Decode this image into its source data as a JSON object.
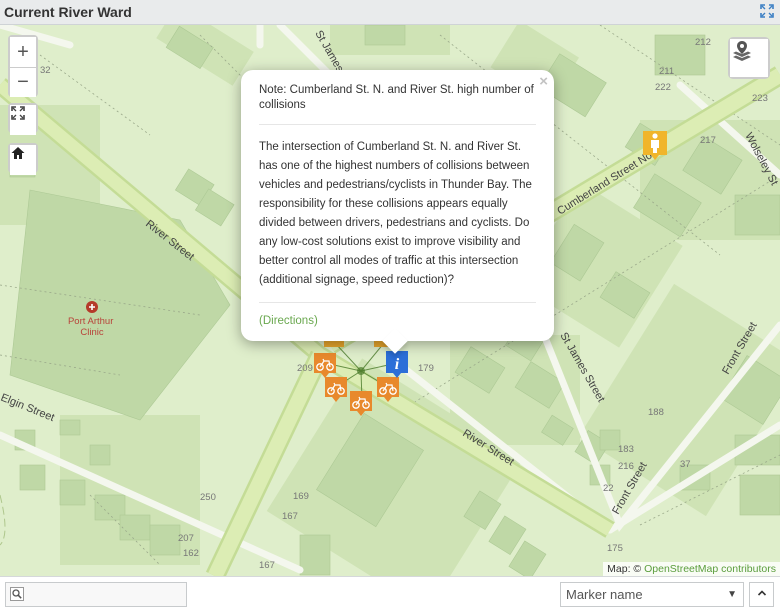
{
  "header": {
    "title": "Current River Ward",
    "expand_icon": "expand-icon"
  },
  "map": {
    "zoom_in": "+",
    "zoom_out": "−",
    "fullscreen_icon": "fullscreen-icon",
    "home_icon": "home-icon",
    "layers_icon": "layers-icon",
    "streets": [
      "River Street",
      "River Street",
      "Cumberland Street No",
      "St James St",
      "St James Street",
      "Wolseley St",
      "Front Street",
      "Front Street",
      "Elgin Street"
    ],
    "poi": {
      "name": "Port Arthur Clinic",
      "icon": "hospital-icon"
    },
    "house_numbers": [
      "212",
      "211",
      "222",
      "223",
      "217",
      "188",
      "183",
      "216",
      "22",
      "37",
      "175",
      "250",
      "169",
      "167",
      "207",
      "162",
      "167",
      "209",
      "179",
      "32"
    ],
    "markers": [
      "pedestrian-marker",
      "cyclist-marker",
      "cyclist-marker",
      "cyclist-marker",
      "cyclist-marker",
      "info-marker"
    ],
    "attribution": {
      "prefix": "Map: ©",
      "link": "OpenStreetMap contributors"
    }
  },
  "popup": {
    "close": "×",
    "heading": "Note: Cumberland St. N. and River St. high number of collisions",
    "body": "The intersection of Cumberland St. N. and River St. has one of the highest numbers of collisions between vehicles and pedestrians/cyclists in Thunder Bay.  The responsibility for these collisions appears equally divided between drivers, pedestrians and cyclists.  Do any low-cost solutions exist to improve visibility and better control all modes of traffic at this intersection (additional signage, speed reduction)?",
    "directions": "(Directions)"
  },
  "footer": {
    "search_icon": "search-icon",
    "search_value": "",
    "marker_select": "Marker name",
    "up_icon": "chevron-up-icon"
  }
}
